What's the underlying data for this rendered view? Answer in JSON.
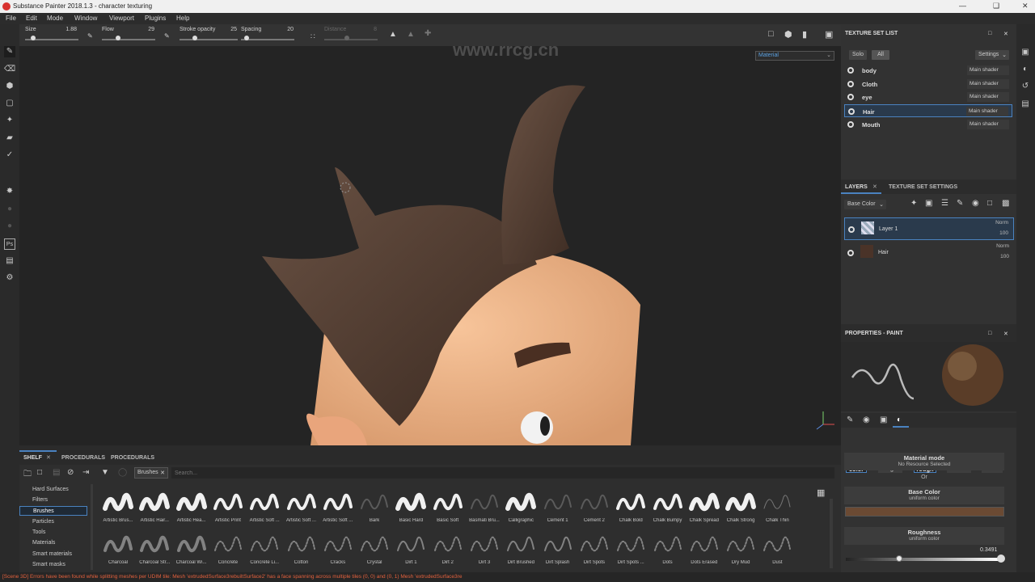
{
  "window": {
    "title": "Substance Painter 2018.1.3 - character texturing"
  },
  "menu": [
    "File",
    "Edit",
    "Mode",
    "Window",
    "Viewport",
    "Plugins",
    "Help"
  ],
  "tool_options": {
    "size_label": "Size",
    "size_value": "1.88",
    "flow_label": "Flow",
    "flow_value": "29",
    "stroke_opacity_label": "Stroke opacity",
    "stroke_opacity_value": "25",
    "spacing_label": "Spacing",
    "spacing_value": "20",
    "distance_label": "Distance",
    "distance_value": "8"
  },
  "viewport": {
    "mode_select": "Material",
    "watermark": "www.rrcg.cn"
  },
  "texture_set_list": {
    "title": "TEXTURE SET LIST",
    "solo": "Solo",
    "all": "All",
    "settings": "Settings",
    "sets": [
      {
        "name": "body",
        "shader": "Main shader"
      },
      {
        "name": "Cloth",
        "shader": "Main shader"
      },
      {
        "name": "eye",
        "shader": "Main shader"
      },
      {
        "name": "Hair",
        "shader": "Main shader"
      },
      {
        "name": "Mouth",
        "shader": "Main shader"
      }
    ],
    "selected": "Hair"
  },
  "layers": {
    "tab_layers": "LAYERS",
    "tab_settings": "TEXTURE SET SETTINGS",
    "channel": "Base Color",
    "items": [
      {
        "name": "Layer 1",
        "blend": "Norm",
        "opacity": "100"
      },
      {
        "name": "Hair",
        "blend": "Norm",
        "opacity": "100"
      }
    ]
  },
  "properties": {
    "title": "PROPERTIES - PAINT",
    "channels": [
      "color",
      "height",
      "rough",
      "metal",
      "nrm"
    ],
    "material_mode": "Material mode",
    "no_resource": "No Resource Selected",
    "or": "Or",
    "base_color": "Base Color",
    "uniform_color": "uniform color",
    "roughness": "Roughness",
    "roughness_uniform": "uniform color",
    "roughness_value": "0.3491",
    "roughness_fraction": 0.3491,
    "base_color_hex": "#6b4a33"
  },
  "shelf": {
    "tabs": [
      "SHELF",
      "PROCEDURALS",
      "PROCEDURALS"
    ],
    "filter_tag": "Brushes",
    "search_placeholder": "Search...",
    "categories": [
      "Hard Surfaces",
      "Filters",
      "Brushes",
      "Particles",
      "Tools",
      "Materials",
      "Smart materials",
      "Smart masks"
    ],
    "selected_category": "Brushes",
    "row1": [
      "Artistic Brus...",
      "Artistic Hair...",
      "Artistic Hea...",
      "Artistic Print",
      "Artistic Soft ...",
      "Artistic Soft ...",
      "Artistic Soft ...",
      "Bark",
      "Basic Hard",
      "Basic Soft",
      "Basmati Bru...",
      "Calligraphic",
      "Cement 1",
      "Cement 2",
      "Chalk Bold",
      "Chalk Bumpy",
      "Chalk Spread",
      "Chalk Strong",
      "Chalk Thin"
    ],
    "row2": [
      "Charcoal",
      "Charcoal Str...",
      "Charcoal Wi...",
      "Concrete",
      "Concrete Li...",
      "Cotton",
      "Cracks",
      "Crystal",
      "Dirt 1",
      "Dirt 2",
      "Dirt 3",
      "Dirt Brushed",
      "Dirt Splash",
      "Dirt Spots",
      "Dirt Spots ...",
      "Dots",
      "Dots Erased",
      "Dry Mud",
      "Dust"
    ]
  },
  "status": "[Scene 3D] Errors have been found while splitting meshes per UDIM tile: Mesh 'extrudedSurface3rebuiltSurface2' has a face spanning across multiple tiles (0, 0) and (0, 1) Mesh 'extrudedSurface3re"
}
